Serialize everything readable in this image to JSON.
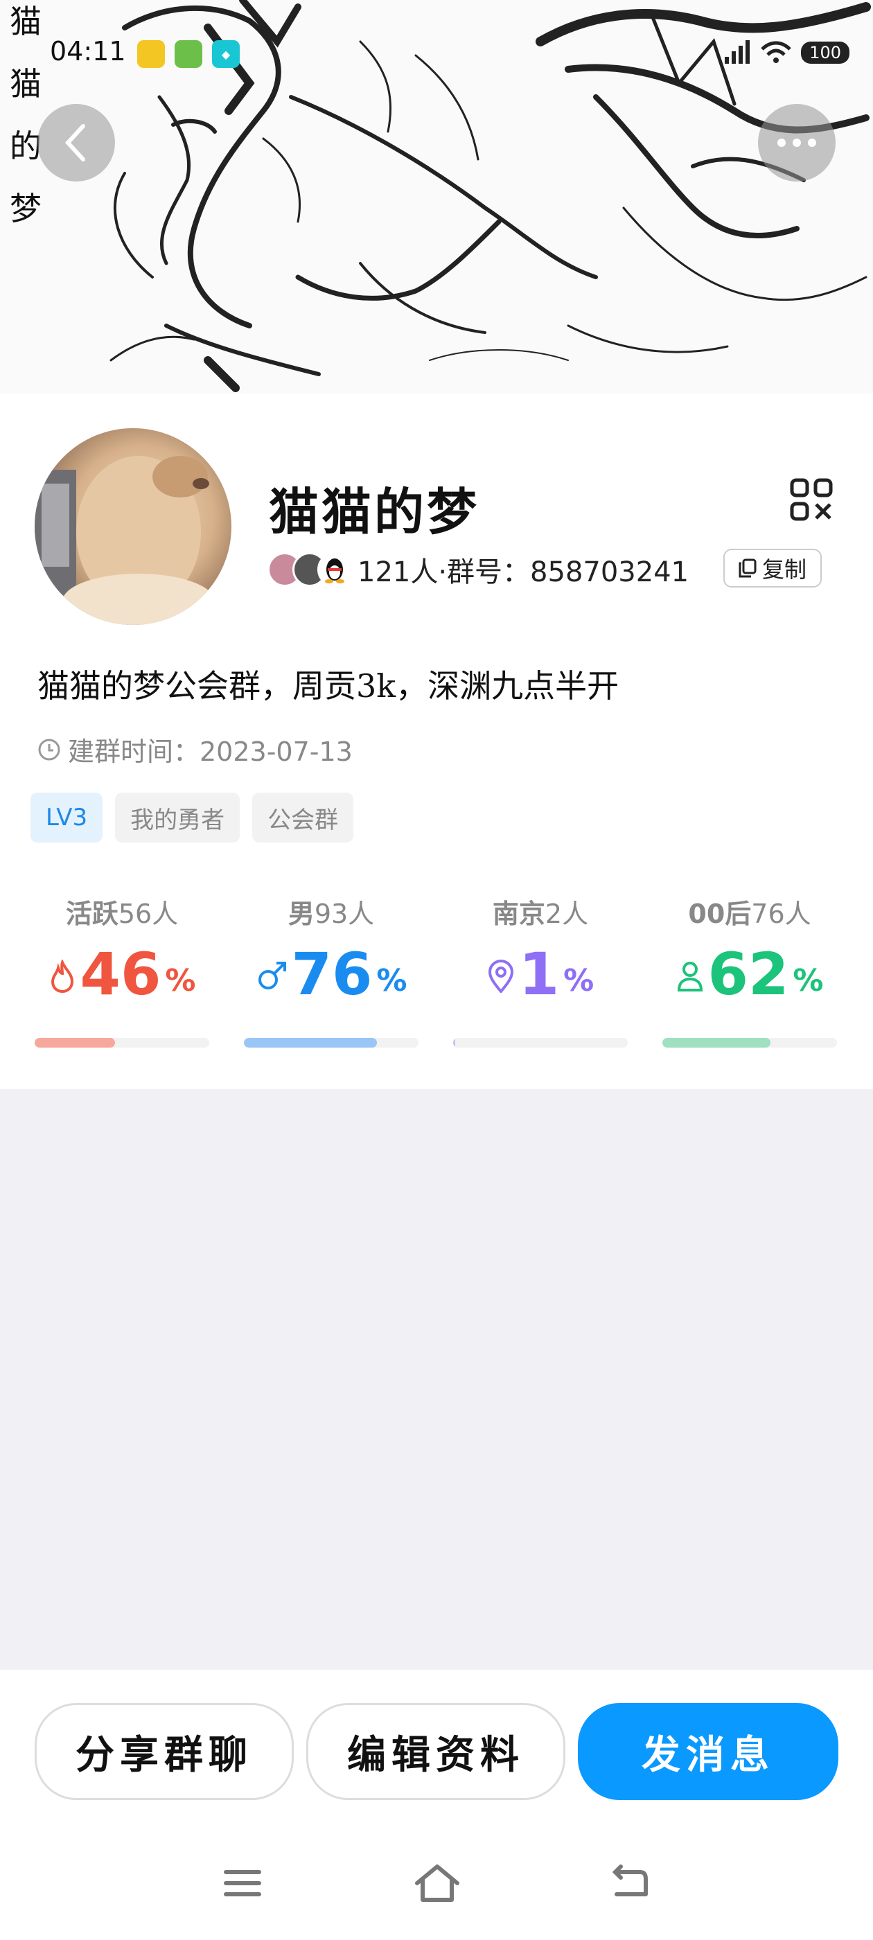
{
  "status_bar": {
    "time": "04:11",
    "battery": "100"
  },
  "banner": {
    "vertical_text": [
      "猫",
      "猫",
      "的",
      "梦"
    ]
  },
  "group": {
    "name": "猫猫的梦",
    "member_count_text": "121人·群号：858703241",
    "copy_label": "复制",
    "description": "猫猫的梦公会群，周贡3k，深渊九点半开",
    "created_text": "建群时间：2023-07-13",
    "tags": [
      "LV3",
      "我的勇者",
      "公会群"
    ]
  },
  "stats": [
    {
      "label": "活跃",
      "count": "56人",
      "value": "46",
      "unit": "%",
      "fraction": 0.46,
      "color": "#f0553f",
      "bar_color": "#f7a89c",
      "icon": "flame-icon"
    },
    {
      "label": "男",
      "count": "93人",
      "value": "76",
      "unit": "%",
      "fraction": 0.76,
      "color": "#1a8cf0",
      "bar_color": "#99c6f6",
      "icon": "male-icon"
    },
    {
      "label": "南京",
      "count": "2人",
      "value": "1",
      "unit": "%",
      "fraction": 0.01,
      "color": "#8e6ff5",
      "bar_color": "#c9bdf7",
      "icon": "location-icon"
    },
    {
      "label": "00后",
      "count": "76人",
      "value": "62",
      "unit": "%",
      "fraction": 0.62,
      "color": "#1cc37a",
      "bar_color": "#9ee0bf",
      "icon": "person-icon"
    }
  ],
  "actions": {
    "share": "分享群聊",
    "edit": "编辑资料",
    "send": "发消息"
  },
  "colors": {
    "primary": "#0a99ff",
    "page_bg": "#f0f0f5"
  }
}
